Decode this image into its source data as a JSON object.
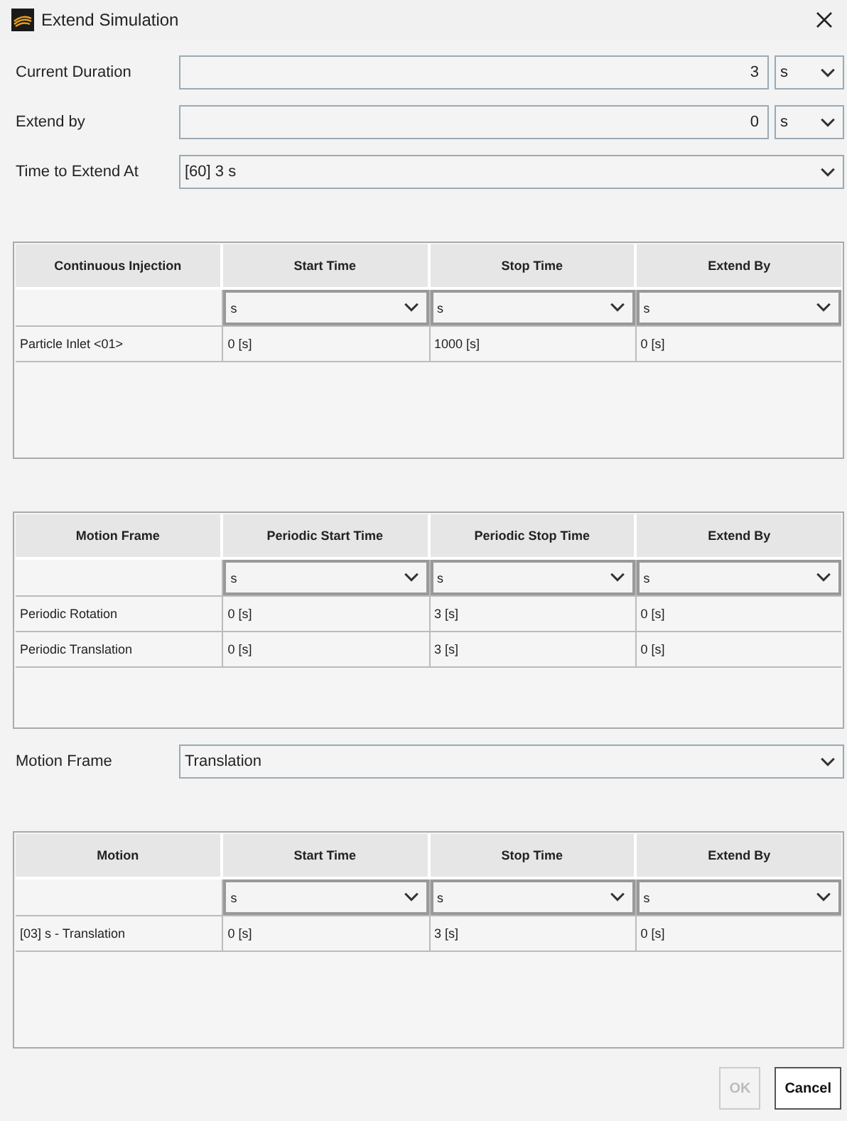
{
  "window": {
    "title": "Extend Simulation"
  },
  "fields": [
    {
      "label": "Current Duration",
      "value": "3",
      "unit": "s"
    },
    {
      "label": "Extend by",
      "value": "0",
      "unit": "s"
    }
  ],
  "time_to_extend_at": {
    "label": "Time to Extend At",
    "value": "[60] 3 s"
  },
  "injection_table": {
    "columns": [
      "Continuous Injection",
      "Start Time",
      "Stop Time",
      "Extend By"
    ],
    "units": [
      "s",
      "s",
      "s"
    ],
    "rows": [
      [
        "Particle Inlet <01>",
        "0 [s]",
        "1000 [s]",
        "0 [s]"
      ]
    ]
  },
  "motion_table": {
    "columns": [
      "Motion Frame",
      "Periodic Start Time",
      "Periodic Stop Time",
      "Extend By"
    ],
    "units": [
      "s",
      "s",
      "s"
    ],
    "rows": [
      [
        "Periodic Rotation",
        "0 [s]",
        "3 [s]",
        "0 [s]"
      ],
      [
        "Periodic Translation",
        "0 [s]",
        "3 [s]",
        "0 [s]"
      ]
    ]
  },
  "motion_frame": {
    "label": "Motion Frame",
    "value": "Translation"
  },
  "motion_time_table": {
    "columns": [
      "Motion",
      "Start Time",
      "Stop Time",
      "Extend By"
    ],
    "units": [
      "s",
      "s",
      "s"
    ],
    "rows": [
      [
        "[03] s - Translation",
        "0 [s]",
        "3 [s]",
        "0 [s]"
      ]
    ]
  },
  "buttons": [
    {
      "label": "OK",
      "disabled": true
    },
    {
      "label": "Cancel",
      "disabled": false
    }
  ]
}
